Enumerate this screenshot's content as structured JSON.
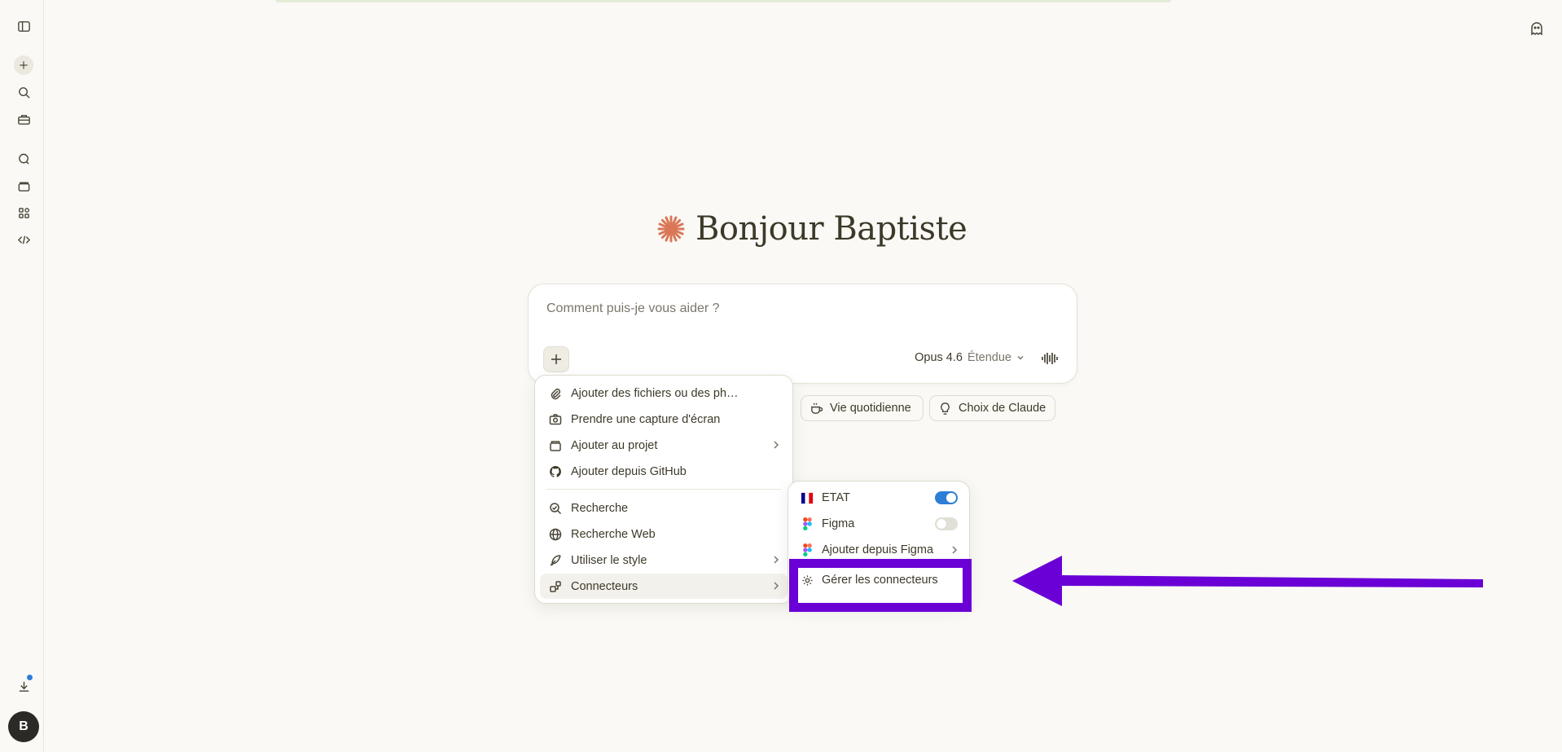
{
  "sidebar": {
    "icons": [
      "sidebar-toggle-icon",
      "new-chat-icon",
      "search-icon",
      "toolbox-icon",
      "chats-icon",
      "projects-icon",
      "artifacts-icon",
      "code-icon",
      "download-icon"
    ],
    "avatar_initial": "B"
  },
  "main": {
    "greeting": "Bonjour Baptiste",
    "composer": {
      "placeholder": "Comment puis-je vous aider ?",
      "model": "Opus 4.6",
      "effort": "Étendue"
    },
    "chips": [
      {
        "label": "Vie quotidienne",
        "icon": "coffee-icon"
      },
      {
        "label": "Choix de Claude",
        "icon": "lightbulb-icon"
      }
    ]
  },
  "menu": {
    "items": [
      {
        "label": "Ajouter des fichiers ou des ph…",
        "icon": "paperclip-icon"
      },
      {
        "label": "Prendre une capture d'écran",
        "icon": "camera-icon"
      },
      {
        "label": "Ajouter au projet",
        "icon": "project-icon"
      },
      {
        "label": "Ajouter depuis GitHub",
        "icon": "github-icon"
      },
      {
        "label": "Recherche",
        "icon": "research-icon"
      },
      {
        "label": "Recherche Web",
        "icon": "globe-icon"
      },
      {
        "label": "Utiliser le style",
        "icon": "feather-icon"
      },
      {
        "label": "Connecteurs",
        "icon": "connectors-icon"
      }
    ]
  },
  "submenu": {
    "items": [
      {
        "label": "ETAT",
        "toggle": true
      },
      {
        "label": "Figma",
        "toggle": false
      },
      {
        "label": "Ajouter depuis Figma"
      },
      {
        "label": "Gérer les connecteurs"
      }
    ]
  },
  "colors": {
    "background": "#faf9f5",
    "accent_star": "#d97757",
    "toggle_on": "#2e7dd7",
    "annotation": "#6a00d6"
  }
}
